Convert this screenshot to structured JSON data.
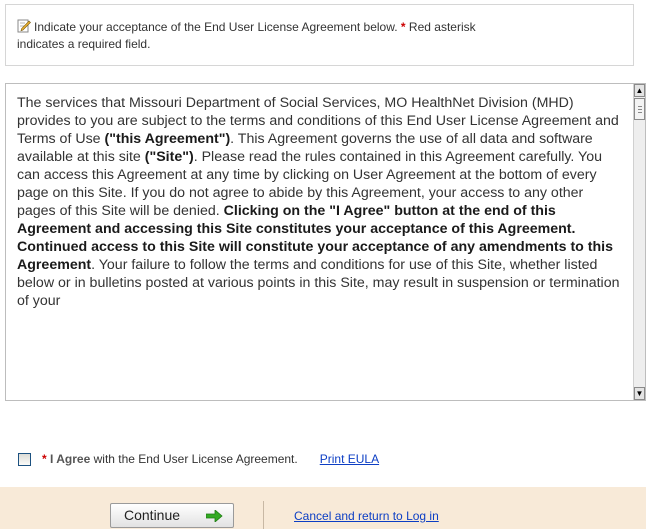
{
  "instructions": {
    "icon": "pencil-edit-icon",
    "text": "Indicate your acceptance of the End User License Agreement below.",
    "required_marker": "*",
    "required_note_1": "Red asterisk",
    "required_note_2": "indicates a required field."
  },
  "eula": {
    "p1": "The services that Missouri Department of Social Services, MO HealthNet Division (MHD) provides to you are subject to the terms and conditions of this End User License Agreement and Terms of Use ",
    "b1": "(\"this Agreement\")",
    "p2": ". This Agreement governs the use of all data and software available at this site ",
    "b2": "(\"Site\")",
    "p3": ". Please read the rules contained in this Agreement carefully. You can access this Agreement at any time by clicking on User Agreement at the bottom of every page on this Site. If you do not agree to abide by this Agreement, your access to any other pages of this Site will be denied. ",
    "b3": "Clicking on the \"I Agree\" button at the end of this Agreement and accessing this Site constitutes your acceptance of this Agreement. Continued access to this Site will constitute your acceptance of any amendments to this Agreement",
    "p4": ". Your failure to follow the terms and conditions for use of this Site, whether listed below or in bulletins posted at various points in this Site, may result in suspension or termination of your"
  },
  "agreement": {
    "required_marker": "*",
    "agree_label": "I Agree",
    "agree_suffix": "with the End User License Agreement.",
    "print_link": "Print EULA",
    "checked": false
  },
  "footer": {
    "continue_label": "Continue",
    "continue_icon": "green-arrow-right-icon",
    "cancel_link": "Cancel and return to Log in"
  },
  "colors": {
    "required": "#cc0000",
    "link": "#0c3ec4",
    "footer_bg": "#f8ead8",
    "arrow": "#33aa22"
  }
}
